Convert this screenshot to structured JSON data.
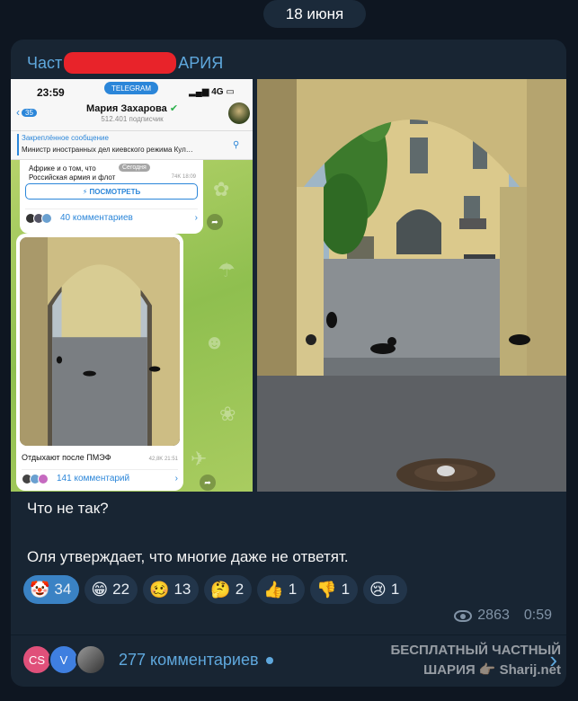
{
  "date_label": "18 июня",
  "channel": {
    "name_prefix": "Част",
    "name_suffix": "АРИЯ"
  },
  "embedded_screenshot": {
    "time": "23:59",
    "telegram_badge": "TELEGRAM",
    "signal": "4G",
    "back_count": "35",
    "chat_name": "Мария Захарова",
    "subscribers": "512.401 подписчик",
    "pinned_title": "Закреплённое сообщение",
    "pinned_text": "Министр иностранных дел киевского режима Кул…",
    "post1_line1": "Африке и о том, что",
    "post1_line2": "Российская армия и флот",
    "post1_date_chip": "Сегодня",
    "post1_meta": "74K 18:09",
    "post1_button": "⚡ ПОСМОТРЕТЬ",
    "post1_comments": "40 комментариев",
    "post2_caption": "Отдыхают после ПМЭФ",
    "post2_meta": "42,8K 21:51",
    "post2_comments": "141 комментарий"
  },
  "post_text": {
    "line1": "Что не так?",
    "line2": "Оля утверждает, что многие даже не ответят."
  },
  "reactions": [
    {
      "emoji": "🤡",
      "count": "34",
      "active": true
    },
    {
      "emoji": "😁",
      "count": "22",
      "active": false
    },
    {
      "emoji": "🥴",
      "count": "13",
      "active": false
    },
    {
      "emoji": "🤔",
      "count": "2",
      "active": false
    },
    {
      "emoji": "👍",
      "count": "1",
      "active": false
    },
    {
      "emoji": "👎",
      "count": "1",
      "active": false
    },
    {
      "emoji": "😢",
      "count": "1",
      "active": false
    }
  ],
  "views": "2863",
  "post_time": "0:59",
  "comments": {
    "avatars": [
      "CS",
      "V",
      ""
    ],
    "label": "277 комментариев"
  },
  "watermark": {
    "line1": "БЕСПЛАТНЫЙ ЧАСТНЫЙ",
    "line2": "ШАРИЯ 👉🏻 Sharij.net"
  },
  "colors": {
    "background": "#0e1621",
    "bubble": "#182533",
    "accent": "#5fa8dd",
    "active_reaction": "#3a82c4"
  }
}
